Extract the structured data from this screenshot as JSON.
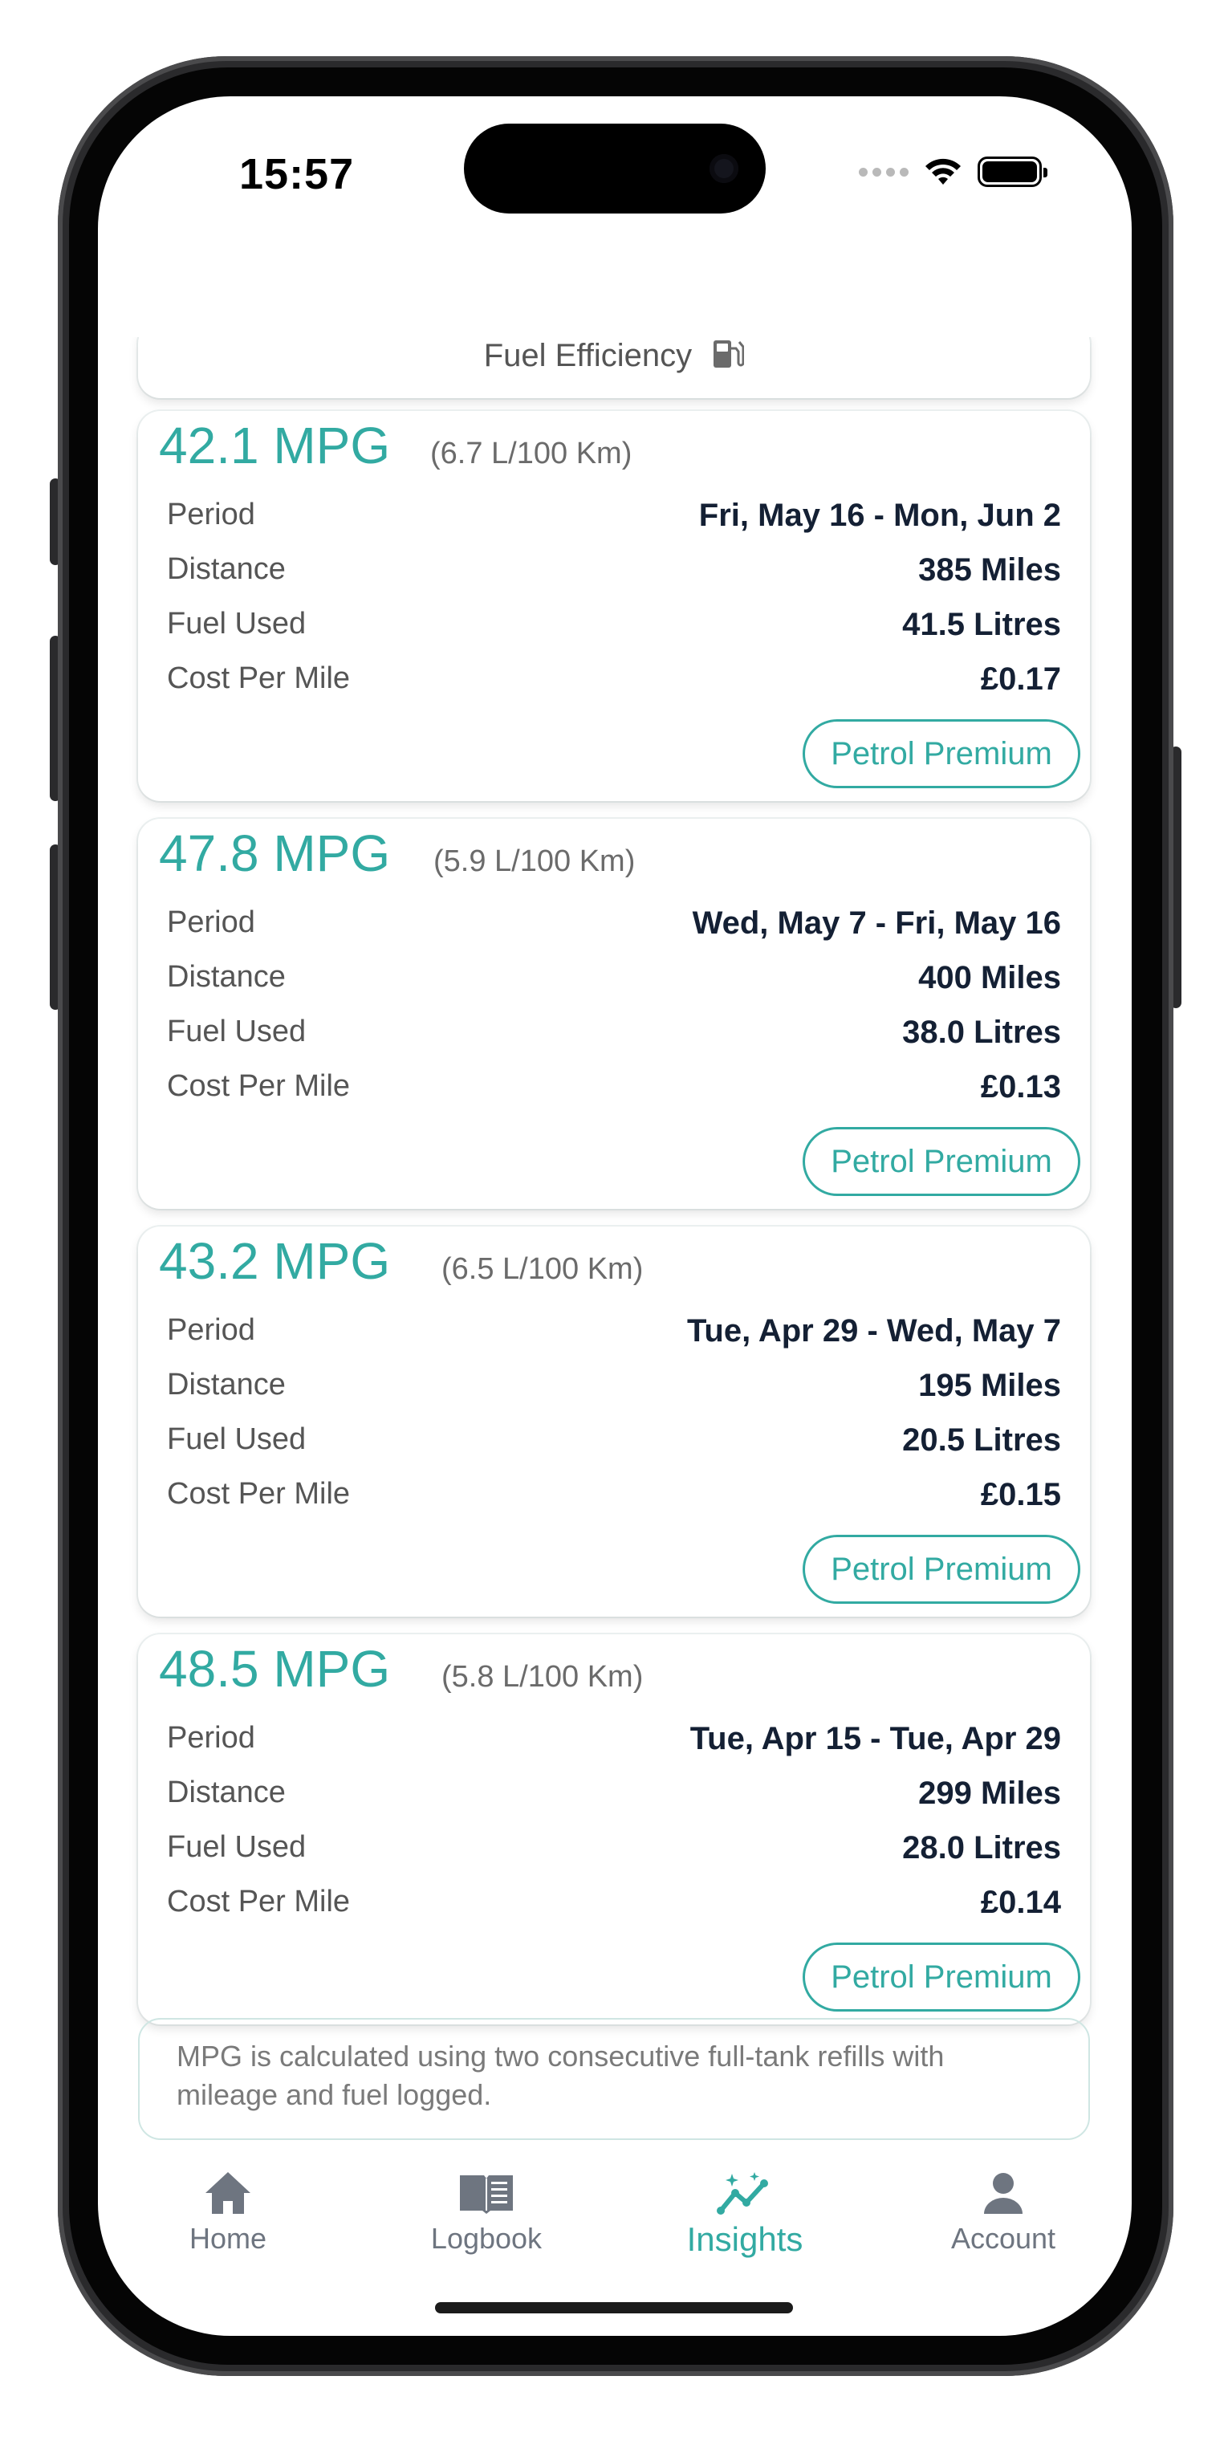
{
  "status_bar": {
    "time": "15:57"
  },
  "header": {
    "title": "Fuel Efficiency"
  },
  "colors": {
    "accent": "#32aaa2",
    "value_text": "#142034",
    "label_text": "#555555"
  },
  "entries": [
    {
      "mpg": "42.1 MPG",
      "lkm": "(6.7 L/100 Km)",
      "period_label": "Period",
      "period": "Fri, May 16 - Mon, Jun 2",
      "distance_label": "Distance",
      "distance": "385 Miles",
      "fuel_label": "Fuel Used",
      "fuel": "41.5 Litres",
      "cost_label": "Cost Per Mile",
      "cost": "£0.17",
      "fuel_type": "Petrol Premium"
    },
    {
      "mpg": "47.8 MPG",
      "lkm": "(5.9 L/100 Km)",
      "period_label": "Period",
      "period": "Wed, May 7 - Fri, May 16",
      "distance_label": "Distance",
      "distance": "400 Miles",
      "fuel_label": "Fuel Used",
      "fuel": "38.0 Litres",
      "cost_label": "Cost Per Mile",
      "cost": "£0.13",
      "fuel_type": "Petrol Premium"
    },
    {
      "mpg": "43.2 MPG",
      "lkm": "(6.5 L/100 Km)",
      "period_label": "Period",
      "period": "Tue, Apr 29 - Wed, May 7",
      "distance_label": "Distance",
      "distance": "195 Miles",
      "fuel_label": "Fuel Used",
      "fuel": "20.5 Litres",
      "cost_label": "Cost Per Mile",
      "cost": "£0.15",
      "fuel_type": "Petrol Premium"
    },
    {
      "mpg": "48.5 MPG",
      "lkm": "(5.8 L/100 Km)",
      "period_label": "Period",
      "period": "Tue, Apr 15 - Tue, Apr 29",
      "distance_label": "Distance",
      "distance": "299 Miles",
      "fuel_label": "Fuel Used",
      "fuel": "28.0 Litres",
      "cost_label": "Cost Per Mile",
      "cost": "£0.14",
      "fuel_type": "Petrol Premium"
    }
  ],
  "footnote": "MPG is calculated using two consecutive full-tank refills with mileage and fuel logged.",
  "tabs": [
    {
      "label": "Home",
      "icon": "home-icon"
    },
    {
      "label": "Logbook",
      "icon": "book-icon"
    },
    {
      "label": "Insights",
      "icon": "insights-icon",
      "active": true
    },
    {
      "label": "Account",
      "icon": "account-icon"
    }
  ]
}
